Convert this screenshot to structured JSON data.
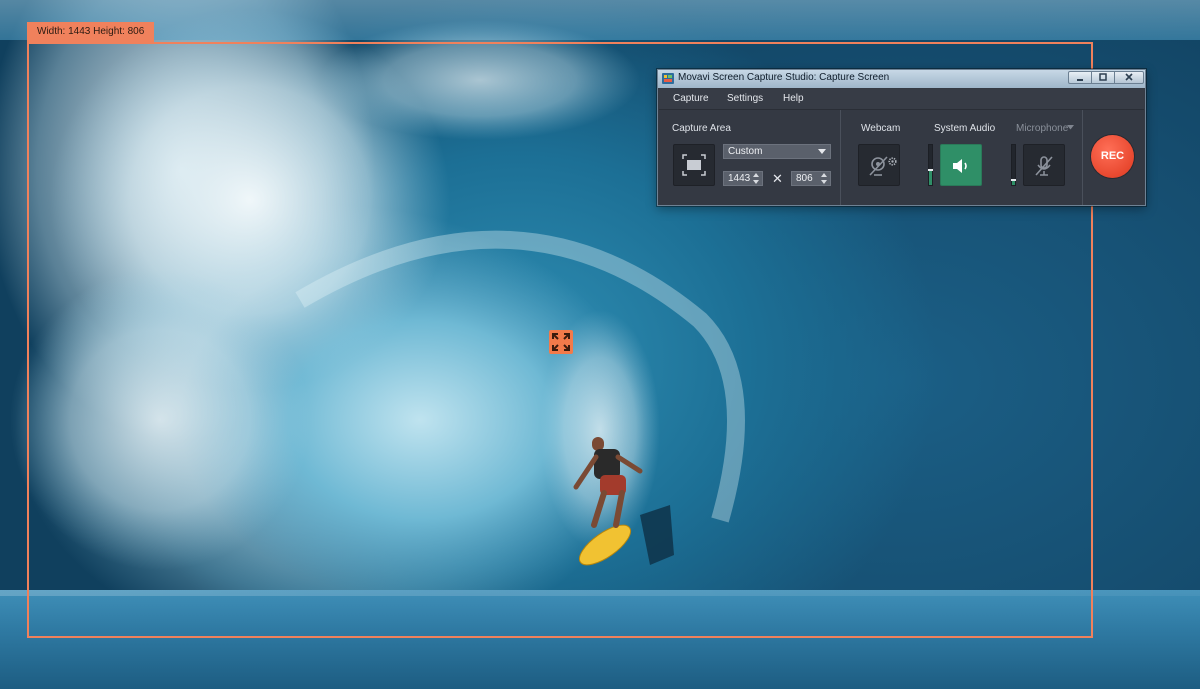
{
  "overlay": {
    "size_label": "Width: 1443 Height: 806",
    "frame_color": "#f0815c",
    "move_handle_icon": "expand-arrows-icon"
  },
  "window": {
    "title": "Movavi Screen Capture Studio: Capture Screen",
    "controls": [
      "minimize-icon",
      "maximize-icon",
      "close-icon"
    ]
  },
  "menu": {
    "items": [
      "Capture",
      "Settings",
      "Help"
    ]
  },
  "capture_area": {
    "label": "Capture Area",
    "area_icon": "screen-frame-icon",
    "preset": "Custom",
    "width": "1443",
    "height": "806",
    "separator": "✕"
  },
  "webcam": {
    "label": "Webcam",
    "icon": "webcam-off-icon",
    "settings_icon": "gear-icon",
    "state": "off"
  },
  "system_audio": {
    "label": "System Audio",
    "icon": "speaker-icon",
    "state": "on",
    "active_color": "#2f8f67",
    "level": 0.35
  },
  "microphone": {
    "label": "Microphone",
    "dropdown_icon": "chevron-down-icon",
    "icon": "microphone-off-icon",
    "state": "off",
    "level": 0.1
  },
  "rec": {
    "label": "REC",
    "color": "#e8482f"
  }
}
